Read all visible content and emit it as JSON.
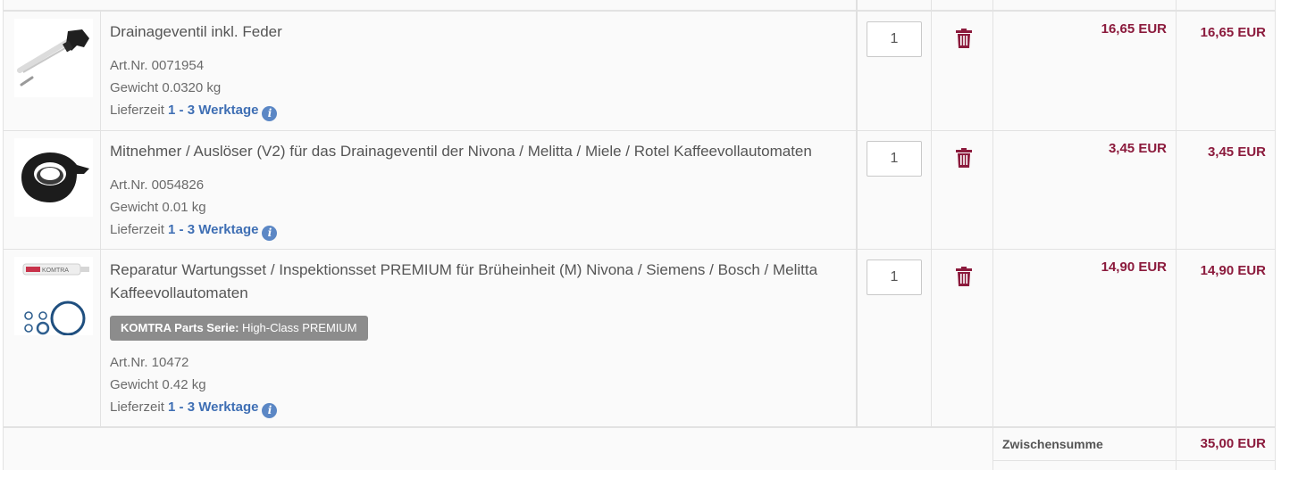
{
  "items": [
    {
      "title": "Drainageventil inkl. Feder",
      "art_nr": "Art.Nr. 0071954",
      "weight": "Gewicht 0.0320 kg",
      "delivery_label": "Lieferzeit",
      "delivery_value": "1 - 3 Werktage",
      "quantity": "1",
      "unit_price": "16,65 EUR",
      "total_price": "16,65 EUR",
      "image_icon": "drain-valve-photo"
    },
    {
      "title": "Mitnehmer / Auslöser (V2) für das Drainageventil der Nivona / Melitta / Miele / Rotel Kaffeevollautomaten",
      "art_nr": "Art.Nr. 0054826",
      "weight": "Gewicht 0.01 kg",
      "delivery_label": "Lieferzeit",
      "delivery_value": "1 - 3 Werktage",
      "quantity": "1",
      "unit_price": "3,45 EUR",
      "total_price": "3,45 EUR",
      "image_icon": "driver-release-photo"
    },
    {
      "title": "Reparatur Wartungsset / Inspektionsset PREMIUM für Brüheinheit (M) Nivona / Siemens / Bosch / Melitta Kaffeevollautomaten",
      "badge_prefix": "KOMTRA Parts Serie:",
      "badge_text": " High-Class PREMIUM",
      "art_nr": "Art.Nr. 10472",
      "weight": "Gewicht 0.42 kg",
      "delivery_label": "Lieferzeit",
      "delivery_value": "1 - 3 Werktage",
      "quantity": "1",
      "unit_price": "14,90 EUR",
      "total_price": "14,90 EUR",
      "image_icon": "maintenance-kit-photo",
      "image_tube_label": "KOMTRA"
    }
  ],
  "summary": {
    "subtotal_label": "Zwischensumme",
    "subtotal_value": "35,00 EUR"
  },
  "icons": {
    "info": "i",
    "delete": "trash-icon"
  },
  "colors": {
    "price": "#8b1a3c",
    "delivery": "#3f6fb4",
    "info_icon": "#5b87c5",
    "badge": "#8c8c8c",
    "trash": "#8b1a3c"
  }
}
